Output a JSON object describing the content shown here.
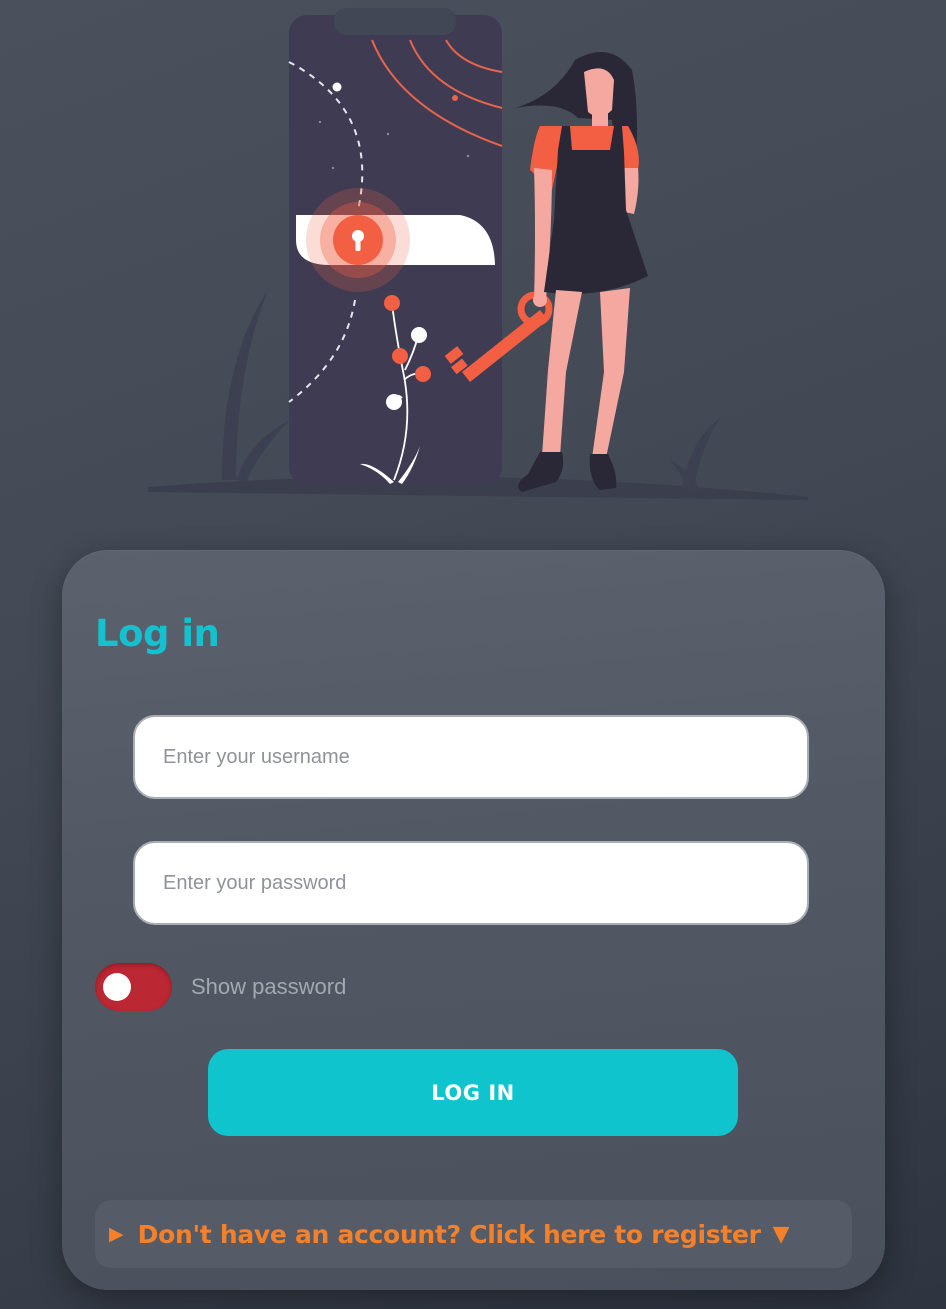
{
  "login_card": {
    "title": "Log in",
    "username_placeholder": "Enter your username",
    "password_placeholder": "Enter your password",
    "show_password_label": "Show password",
    "show_password_on": false,
    "login_button_label": "LOG IN",
    "register_link_text": "Don't have an account? Click here to register"
  },
  "icons": {
    "register_expand": "triangle-right-icon",
    "register_dropdown": "triangle-down-icon",
    "hero": "unlock-illustration"
  },
  "colors": {
    "accent": "#14c2cf",
    "toggle_off": "#bb2733",
    "link": "#f5802a",
    "illustration_accent": "#f25f43"
  }
}
